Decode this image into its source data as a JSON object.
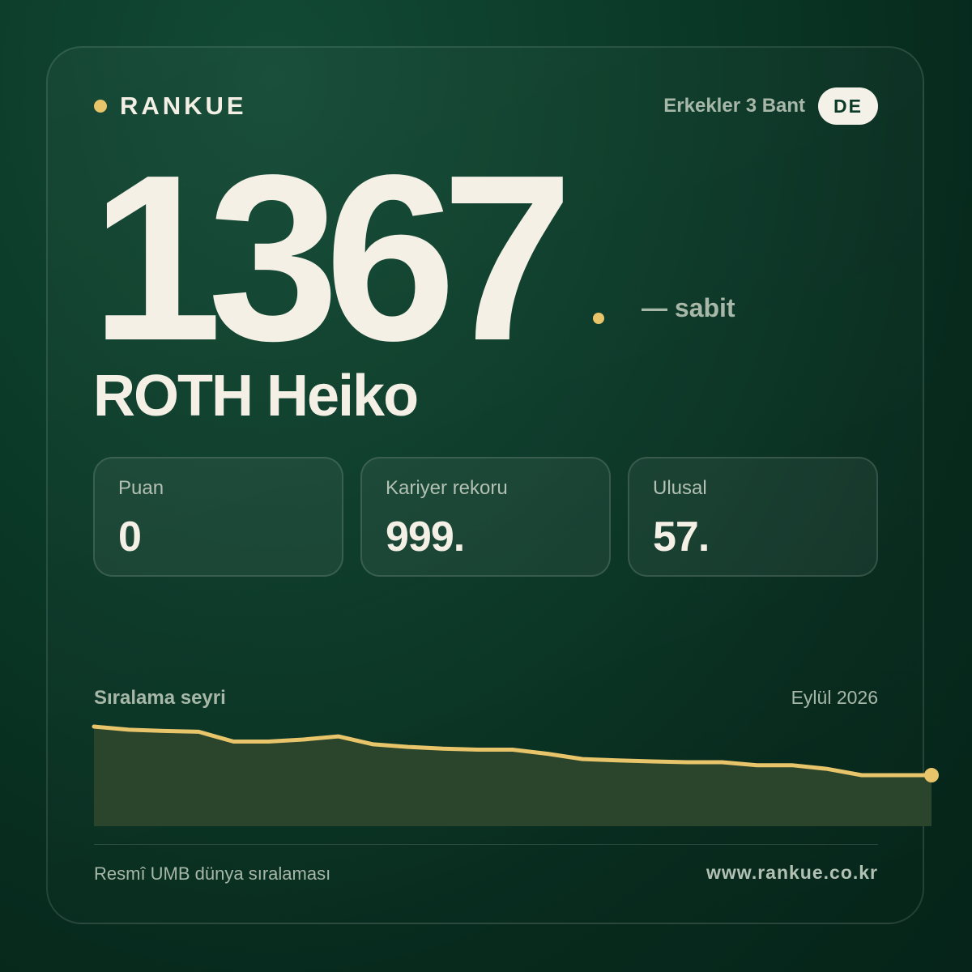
{
  "brand": {
    "name": "RANKUE"
  },
  "category": {
    "label": "Erkekler 3 Bant",
    "country": "DE"
  },
  "rating": {
    "value": "1367",
    "change": "— sabit"
  },
  "player": {
    "name": "ROTH Heiko"
  },
  "stats": [
    {
      "label": "Puan",
      "value": "0"
    },
    {
      "label": "Kariyer rekoru",
      "value": "999."
    },
    {
      "label": "Ulusal",
      "value": "57."
    }
  ],
  "trend": {
    "title": "Sıralama seyri",
    "date": "Eylül 2026"
  },
  "footer": {
    "source": "Resmî UMB dünya sıralaması",
    "url": "www.rankue.co.kr"
  },
  "colors": {
    "accent": "#e8c56a",
    "background": "#0b3a28",
    "text": "#f4f0e6"
  },
  "chart_data": {
    "type": "area",
    "title": "Sıralama seyri",
    "x": [
      1,
      2,
      3,
      4,
      5,
      6,
      7,
      8,
      9,
      10,
      11,
      12,
      13,
      14,
      15,
      16,
      17,
      18,
      19,
      20,
      21,
      22,
      23,
      24,
      25
    ],
    "values": [
      1000,
      968,
      956,
      948,
      850,
      850,
      870,
      902,
      822,
      796,
      778,
      768,
      768,
      727,
      674,
      660,
      650,
      642,
      642,
      612,
      612,
      576,
      512,
      512,
      512
    ],
    "ylim": [
      0,
      1000
    ],
    "grid": false,
    "note": "rank trend; unitless, y axis not printed"
  }
}
